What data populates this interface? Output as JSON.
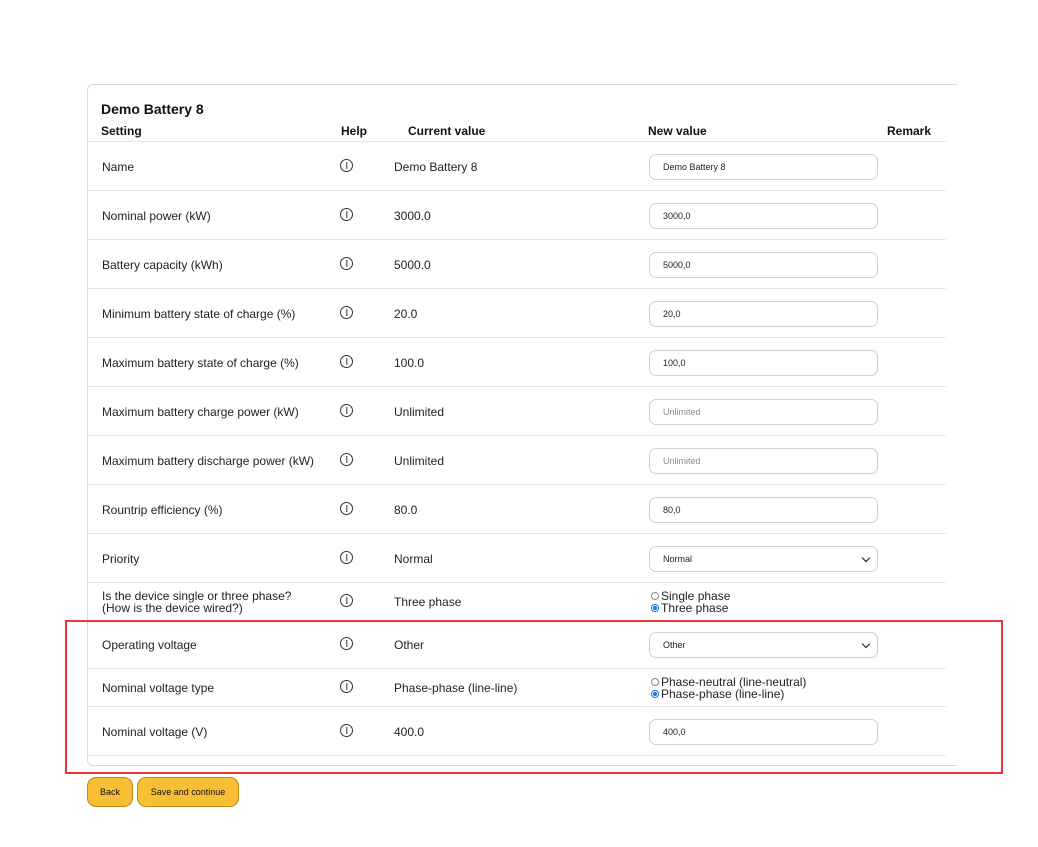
{
  "panel": {
    "title": "Demo Battery 8"
  },
  "headers": {
    "setting": "Setting",
    "help": "Help",
    "current": "Current value",
    "new": "New value",
    "remark": "Remark"
  },
  "rows": [
    {
      "label": "Name",
      "current": "Demo Battery 8",
      "control": "input",
      "value": "Demo Battery 8",
      "placeholder": ""
    },
    {
      "label": "Nominal power (kW)",
      "current": "3000.0",
      "control": "input",
      "value": "3000,0",
      "placeholder": ""
    },
    {
      "label": "Battery capacity (kWh)",
      "current": "5000.0",
      "control": "input",
      "value": "5000,0",
      "placeholder": ""
    },
    {
      "label": "Minimum battery state of charge (%)",
      "current": "20.0",
      "control": "input",
      "value": "20,0",
      "placeholder": ""
    },
    {
      "label": "Maximum battery state of charge (%)",
      "current": "100.0",
      "control": "input",
      "value": "100,0",
      "placeholder": ""
    },
    {
      "label": "Maximum battery charge power (kW)",
      "current": "Unlimited",
      "control": "input",
      "value": "",
      "placeholder": "Unlimited"
    },
    {
      "label": "Maximum battery discharge power (kW)",
      "current": "Unlimited",
      "control": "input",
      "value": "",
      "placeholder": "Unlimited"
    },
    {
      "label": "Rountrip efficiency (%)",
      "current": "80.0",
      "control": "input",
      "value": "80,0",
      "placeholder": ""
    },
    {
      "label": "Priority",
      "current": "Normal",
      "control": "select",
      "value": "Normal"
    },
    {
      "label": "Is the device single or three phase? (How is the device wired?)",
      "current": "Three phase",
      "control": "radio",
      "options": [
        {
          "label": "Single phase",
          "checked": false
        },
        {
          "label": "Three phase",
          "checked": true
        }
      ]
    },
    {
      "label": "Operating voltage",
      "current": "Other",
      "control": "select",
      "value": "Other"
    },
    {
      "label": "Nominal voltage type",
      "current": "Phase-phase (line-line)",
      "control": "radio",
      "options": [
        {
          "label": "Phase-neutral (line-neutral)",
          "checked": false
        },
        {
          "label": "Phase-phase (line-line)",
          "checked": true
        }
      ]
    },
    {
      "label": "Nominal voltage (V)",
      "current": "400.0",
      "control": "input",
      "value": "400,0",
      "placeholder": ""
    }
  ],
  "buttons": {
    "back": "Back",
    "save": "Save and continue"
  },
  "colors": {
    "accent": "#f9bf34",
    "highlight": "#e53935",
    "radio": "#1a73e8"
  }
}
